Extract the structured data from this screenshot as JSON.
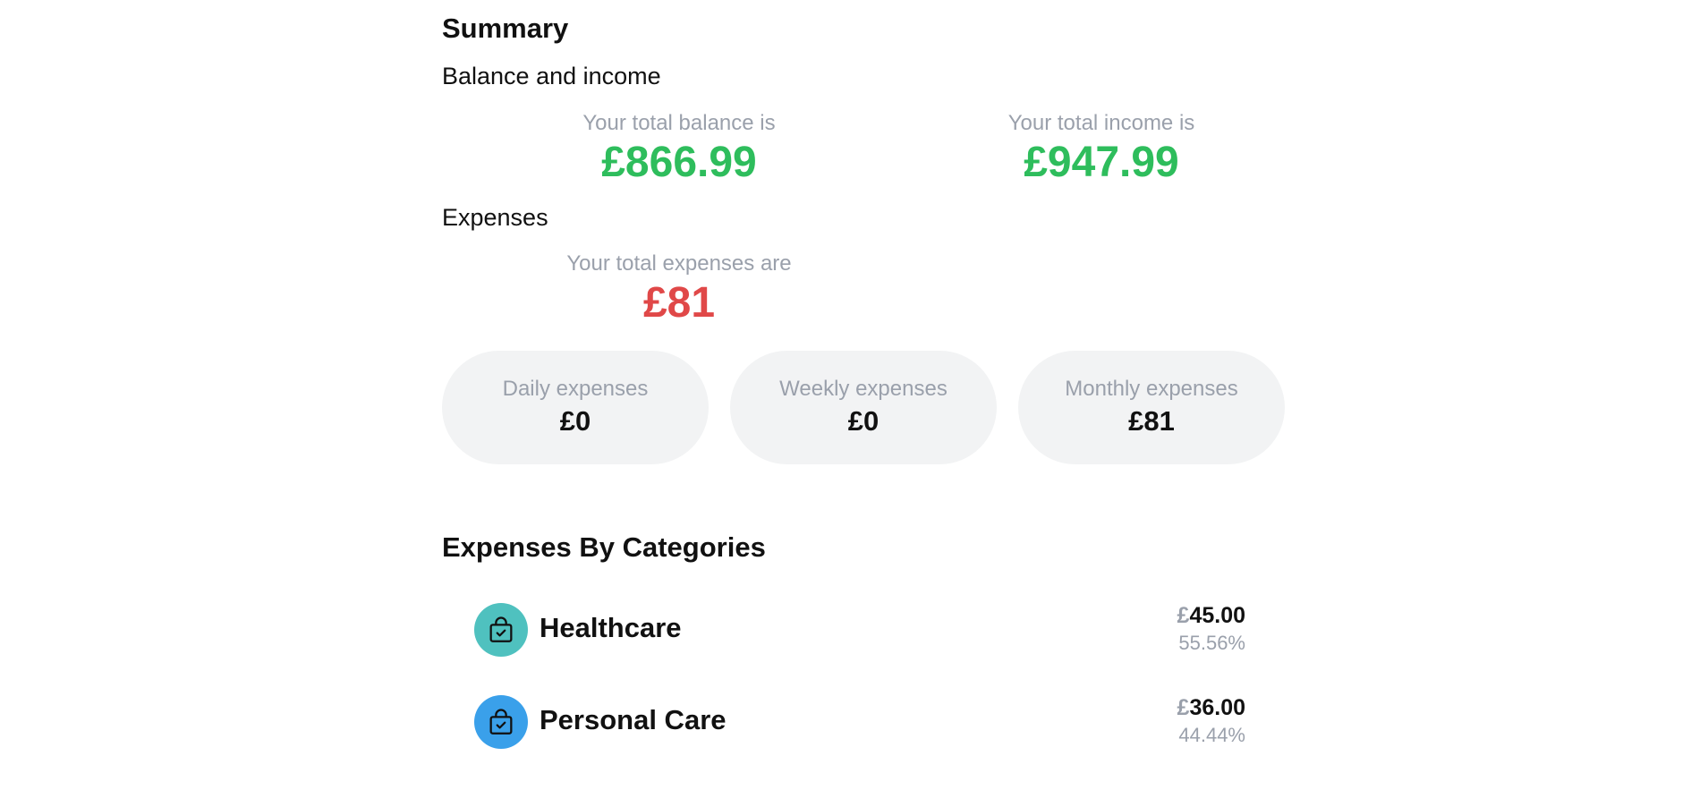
{
  "summary": {
    "title": "Summary",
    "balance_income_heading": "Balance and income",
    "balance_caption": "Your total balance is",
    "balance_value": "£866.99",
    "income_caption": "Your total income is",
    "income_value": "£947.99",
    "expenses_heading": "Expenses",
    "expenses_caption": "Your total expenses are",
    "expenses_value": "£81",
    "daily_label": "Daily expenses",
    "daily_value": "£0",
    "weekly_label": "Weekly expenses",
    "weekly_value": "£0",
    "monthly_label": "Monthly expenses",
    "monthly_value": "£81"
  },
  "colors": {
    "positive": "#2ebd5c",
    "negative": "#e04848",
    "muted_text": "#9aa0ab",
    "pill_background": "#f2f3f4"
  },
  "categories": {
    "title": "Expenses By Categories",
    "items": [
      {
        "name": "Healthcare",
        "currency": "£",
        "amount": "45.00",
        "percent": "55.56%",
        "icon": "shopping-bag-check-icon",
        "color": "#4fc1bf"
      },
      {
        "name": "Personal Care",
        "currency": "£",
        "amount": "36.00",
        "percent": "44.44%",
        "icon": "shopping-bag-check-icon",
        "color": "#3aa0ea"
      }
    ]
  }
}
